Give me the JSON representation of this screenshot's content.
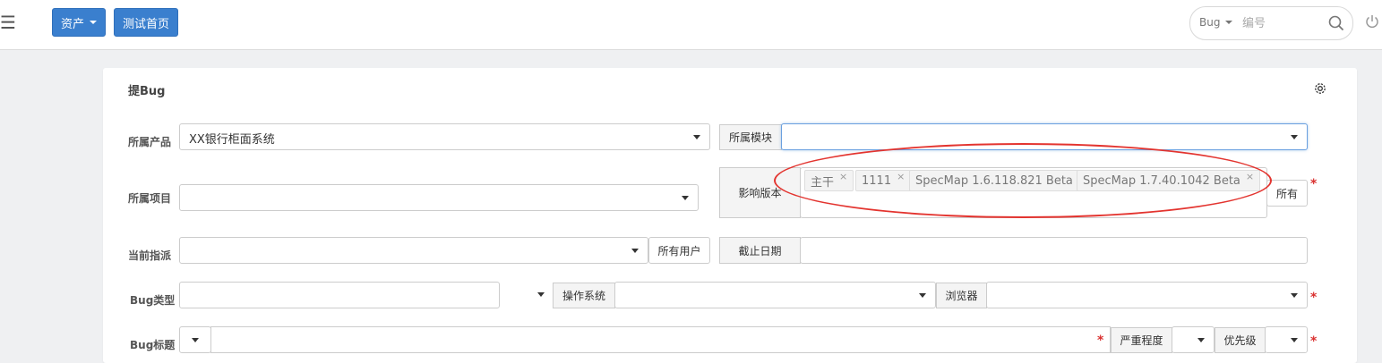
{
  "topbar": {
    "menu_icon_glyph": "☰",
    "assets_label": "资产",
    "test_home_label": "测试首页",
    "search": {
      "type_label": "Bug",
      "placeholder": "编号"
    }
  },
  "form": {
    "title": "提Bug",
    "product": {
      "label": "所属产品",
      "value": "XX银行柜面系统"
    },
    "module": {
      "label": "所属模块",
      "value": ""
    },
    "project": {
      "label": "所属项目",
      "value": ""
    },
    "version": {
      "label": "影响版本",
      "tags": [
        "主干",
        "1111",
        "SpecMap 1.6.118.821 Beta",
        "SpecMap 1.7.40.1042 Beta"
      ],
      "tag_remove": "×",
      "all_label": "所有"
    },
    "assign": {
      "label": "当前指派",
      "all_users_label": "所有用户"
    },
    "deadline": {
      "label": "截止日期",
      "value": ""
    },
    "bug_type": {
      "label": "Bug类型"
    },
    "os": {
      "label": "操作系统"
    },
    "browser": {
      "label": "浏览器"
    },
    "bug_title": {
      "label": "Bug标题"
    },
    "severity": {
      "label": "严重程度"
    },
    "priority": {
      "label": "优先级"
    },
    "required_mark": "*"
  },
  "colors": {
    "accent": "#3a7fce",
    "required": "#d9302f",
    "annotation": "#e3342f"
  }
}
